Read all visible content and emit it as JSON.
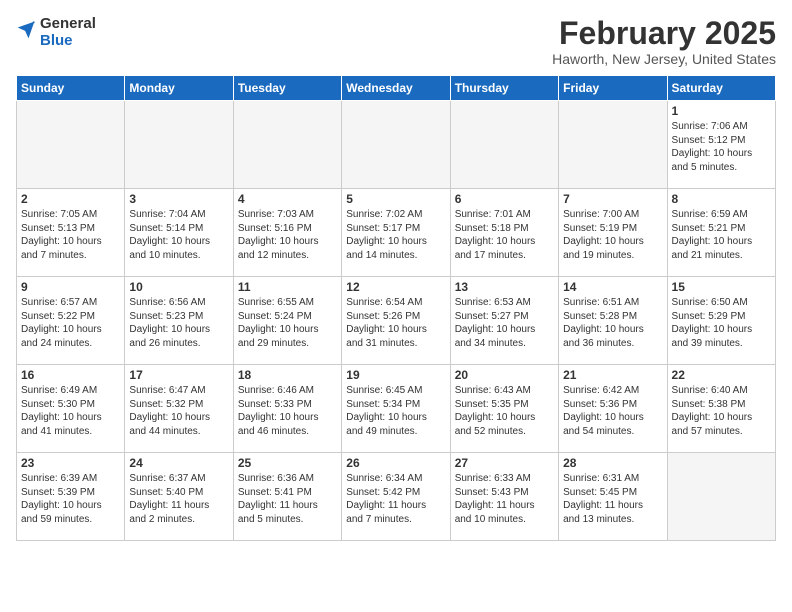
{
  "header": {
    "logo_general": "General",
    "logo_blue": "Blue",
    "month_title": "February 2025",
    "location": "Haworth, New Jersey, United States"
  },
  "weekdays": [
    "Sunday",
    "Monday",
    "Tuesday",
    "Wednesday",
    "Thursday",
    "Friday",
    "Saturday"
  ],
  "weeks": [
    [
      {
        "day": "",
        "info": ""
      },
      {
        "day": "",
        "info": ""
      },
      {
        "day": "",
        "info": ""
      },
      {
        "day": "",
        "info": ""
      },
      {
        "day": "",
        "info": ""
      },
      {
        "day": "",
        "info": ""
      },
      {
        "day": "1",
        "info": "Sunrise: 7:06 AM\nSunset: 5:12 PM\nDaylight: 10 hours\nand 5 minutes."
      }
    ],
    [
      {
        "day": "2",
        "info": "Sunrise: 7:05 AM\nSunset: 5:13 PM\nDaylight: 10 hours\nand 7 minutes."
      },
      {
        "day": "3",
        "info": "Sunrise: 7:04 AM\nSunset: 5:14 PM\nDaylight: 10 hours\nand 10 minutes."
      },
      {
        "day": "4",
        "info": "Sunrise: 7:03 AM\nSunset: 5:16 PM\nDaylight: 10 hours\nand 12 minutes."
      },
      {
        "day": "5",
        "info": "Sunrise: 7:02 AM\nSunset: 5:17 PM\nDaylight: 10 hours\nand 14 minutes."
      },
      {
        "day": "6",
        "info": "Sunrise: 7:01 AM\nSunset: 5:18 PM\nDaylight: 10 hours\nand 17 minutes."
      },
      {
        "day": "7",
        "info": "Sunrise: 7:00 AM\nSunset: 5:19 PM\nDaylight: 10 hours\nand 19 minutes."
      },
      {
        "day": "8",
        "info": "Sunrise: 6:59 AM\nSunset: 5:21 PM\nDaylight: 10 hours\nand 21 minutes."
      }
    ],
    [
      {
        "day": "9",
        "info": "Sunrise: 6:57 AM\nSunset: 5:22 PM\nDaylight: 10 hours\nand 24 minutes."
      },
      {
        "day": "10",
        "info": "Sunrise: 6:56 AM\nSunset: 5:23 PM\nDaylight: 10 hours\nand 26 minutes."
      },
      {
        "day": "11",
        "info": "Sunrise: 6:55 AM\nSunset: 5:24 PM\nDaylight: 10 hours\nand 29 minutes."
      },
      {
        "day": "12",
        "info": "Sunrise: 6:54 AM\nSunset: 5:26 PM\nDaylight: 10 hours\nand 31 minutes."
      },
      {
        "day": "13",
        "info": "Sunrise: 6:53 AM\nSunset: 5:27 PM\nDaylight: 10 hours\nand 34 minutes."
      },
      {
        "day": "14",
        "info": "Sunrise: 6:51 AM\nSunset: 5:28 PM\nDaylight: 10 hours\nand 36 minutes."
      },
      {
        "day": "15",
        "info": "Sunrise: 6:50 AM\nSunset: 5:29 PM\nDaylight: 10 hours\nand 39 minutes."
      }
    ],
    [
      {
        "day": "16",
        "info": "Sunrise: 6:49 AM\nSunset: 5:30 PM\nDaylight: 10 hours\nand 41 minutes."
      },
      {
        "day": "17",
        "info": "Sunrise: 6:47 AM\nSunset: 5:32 PM\nDaylight: 10 hours\nand 44 minutes."
      },
      {
        "day": "18",
        "info": "Sunrise: 6:46 AM\nSunset: 5:33 PM\nDaylight: 10 hours\nand 46 minutes."
      },
      {
        "day": "19",
        "info": "Sunrise: 6:45 AM\nSunset: 5:34 PM\nDaylight: 10 hours\nand 49 minutes."
      },
      {
        "day": "20",
        "info": "Sunrise: 6:43 AM\nSunset: 5:35 PM\nDaylight: 10 hours\nand 52 minutes."
      },
      {
        "day": "21",
        "info": "Sunrise: 6:42 AM\nSunset: 5:36 PM\nDaylight: 10 hours\nand 54 minutes."
      },
      {
        "day": "22",
        "info": "Sunrise: 6:40 AM\nSunset: 5:38 PM\nDaylight: 10 hours\nand 57 minutes."
      }
    ],
    [
      {
        "day": "23",
        "info": "Sunrise: 6:39 AM\nSunset: 5:39 PM\nDaylight: 10 hours\nand 59 minutes."
      },
      {
        "day": "24",
        "info": "Sunrise: 6:37 AM\nSunset: 5:40 PM\nDaylight: 11 hours\nand 2 minutes."
      },
      {
        "day": "25",
        "info": "Sunrise: 6:36 AM\nSunset: 5:41 PM\nDaylight: 11 hours\nand 5 minutes."
      },
      {
        "day": "26",
        "info": "Sunrise: 6:34 AM\nSunset: 5:42 PM\nDaylight: 11 hours\nand 7 minutes."
      },
      {
        "day": "27",
        "info": "Sunrise: 6:33 AM\nSunset: 5:43 PM\nDaylight: 11 hours\nand 10 minutes."
      },
      {
        "day": "28",
        "info": "Sunrise: 6:31 AM\nSunset: 5:45 PM\nDaylight: 11 hours\nand 13 minutes."
      },
      {
        "day": "",
        "info": ""
      }
    ]
  ]
}
